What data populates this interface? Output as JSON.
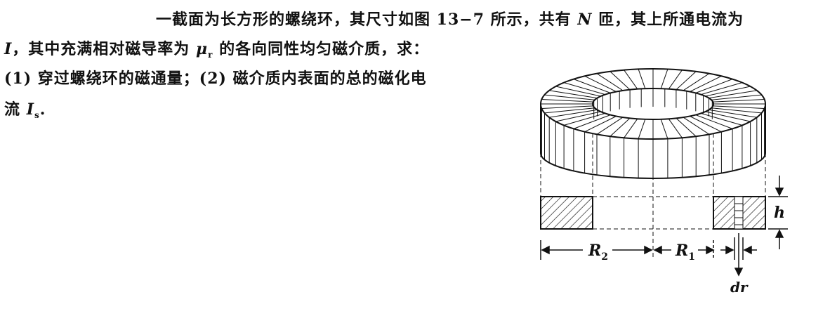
{
  "problem": {
    "line1": "一截面为长方形的螺绕环，其尺寸如图 13−7 所示，共有",
    "var_N": "N",
    "line1_end": "匝，其上所通电流为",
    "var_I": "I",
    "line2": "，其中充满相对磁导率为",
    "var_mu": "μ",
    "mu_sub": "r",
    "line2_end": "的各向同性均匀磁介质，求：",
    "line3": "(1) 穿过螺绕环的磁通量；(2) 磁介质内表面的总的磁化电",
    "line4": "流",
    "var_Is": "I",
    "Is_sub": "s",
    "line4_end": "."
  },
  "figure": {
    "label_R2": "R",
    "label_R2_sub": "2",
    "label_R1": "R",
    "label_R1_sub": "1",
    "label_h": "h",
    "label_dr": "dr"
  }
}
